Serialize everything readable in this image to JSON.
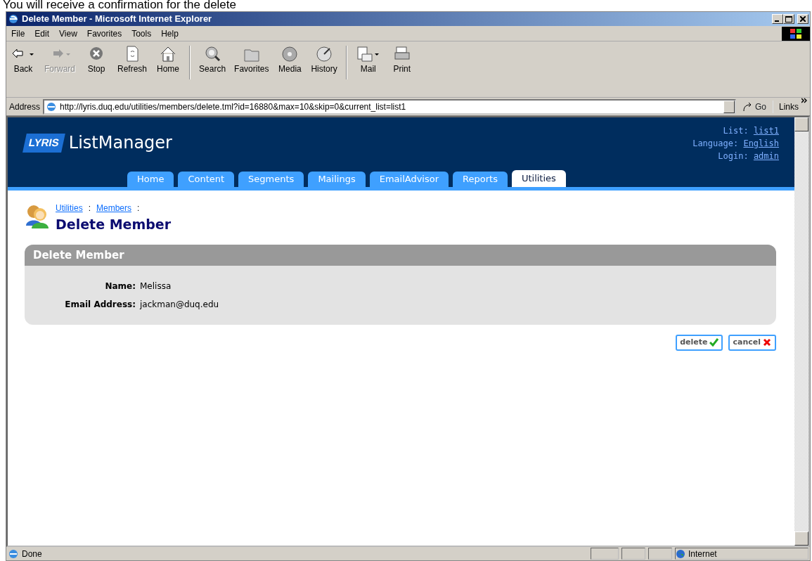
{
  "caption": "You will receive a confirmation for the delete",
  "window": {
    "title": "Delete Member - Microsoft Internet Explorer"
  },
  "menu": [
    "File",
    "Edit",
    "View",
    "Favorites",
    "Tools",
    "Help"
  ],
  "toolbar": {
    "groups": [
      [
        {
          "label": "Back",
          "disabled": false,
          "dropdown": true
        },
        {
          "label": "Forward",
          "disabled": true,
          "dropdown": true
        },
        {
          "label": "Stop",
          "disabled": false,
          "dropdown": false
        },
        {
          "label": "Refresh",
          "disabled": false,
          "dropdown": false
        },
        {
          "label": "Home",
          "disabled": false,
          "dropdown": false
        }
      ],
      [
        {
          "label": "Search",
          "disabled": false,
          "dropdown": false
        },
        {
          "label": "Favorites",
          "disabled": false,
          "dropdown": false
        },
        {
          "label": "Media",
          "disabled": false,
          "dropdown": false
        },
        {
          "label": "History",
          "disabled": false,
          "dropdown": false
        }
      ],
      [
        {
          "label": "Mail",
          "disabled": false,
          "dropdown": true
        },
        {
          "label": "Print",
          "disabled": false,
          "dropdown": false
        }
      ]
    ]
  },
  "address_bar": {
    "label": "Address",
    "value": "http://lyris.duq.edu/utilities/members/delete.tml?id=16880&max=10&skip=0&current_list=list1",
    "go": "Go",
    "links": "Links"
  },
  "app": {
    "logo_badge": "LYRIS",
    "logo_text": "ListManager",
    "info": [
      {
        "label": "List:",
        "value": "list1"
      },
      {
        "label": "Language:",
        "value": "English"
      },
      {
        "label": "Login:",
        "value": "admin"
      }
    ],
    "tabs": [
      {
        "label": "Home",
        "selected": false
      },
      {
        "label": "Content",
        "selected": false
      },
      {
        "label": "Segments",
        "selected": false
      },
      {
        "label": "Mailings",
        "selected": false
      },
      {
        "label": "EmailAdvisor",
        "selected": false
      },
      {
        "label": "Reports",
        "selected": false
      },
      {
        "label": "Utilities",
        "selected": true
      }
    ],
    "breadcrumb": [
      {
        "label": "Utilities",
        "separator": ":"
      },
      {
        "label": "Members",
        "separator": ":"
      }
    ],
    "page_title": "Delete Member",
    "panel": {
      "title": "Delete Member",
      "fields": [
        {
          "label": "Name:",
          "value": "Melissa"
        },
        {
          "label": "Email Address:",
          "value": "jackman@duq.edu"
        }
      ]
    },
    "buttons": [
      {
        "label": "delete",
        "kind": "confirm"
      },
      {
        "label": "cancel",
        "kind": "cancel"
      }
    ]
  },
  "status_bar": {
    "text": "Done",
    "zone": "Internet"
  }
}
